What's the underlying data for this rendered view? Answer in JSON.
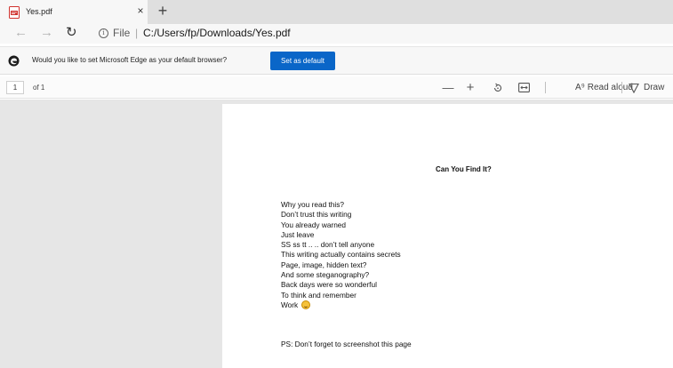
{
  "tab": {
    "title": "Yes.pdf",
    "close_glyph": "×",
    "new_tab_glyph": "+"
  },
  "nav": {
    "back_glyph": "←",
    "forward_glyph": "→",
    "refresh_glyph": "↻",
    "scheme": "File",
    "separator": "|",
    "url": "C:/Users/fp/Downloads/Yes.pdf"
  },
  "infobar": {
    "message": "Would you like to set Microsoft Edge as your default browser?",
    "button_label": "Set as default"
  },
  "pdf_toolbar": {
    "page_number": "1",
    "page_total": "of 1",
    "zoom_out_glyph": "—",
    "zoom_in_glyph": "+",
    "read_aloud_label": "A⁹ Read aloud",
    "draw_label": "Draw"
  },
  "document": {
    "title": "Can You Find It?",
    "lines": [
      "Why you read this?",
      "Don’t trust this writing",
      "You already warned",
      "Just leave",
      "SS ss tt .. .. don’t tell anyone",
      "This writing actually contains secrets",
      "Page, image, hidden text?",
      "And some steganography?",
      "Back days were so wonderful",
      "To think and remember",
      "Work"
    ],
    "ps": "PS: Don’t forget to screenshot this page"
  },
  "colors": {
    "accent": "#0a66c8",
    "tabstrip": "#dfdfdf",
    "viewer_bg": "#e6e6e6",
    "pdf_icon": "#d0312d"
  },
  "icons": {
    "tab": "pdf-file-icon",
    "infobar": "edge-logo-icon",
    "site_info": "info-circle-icon",
    "rotate": "rotate-icon",
    "fit_page": "fit-page-icon",
    "draw": "draw-pen-icon",
    "emoji": "smiling-face-icon"
  }
}
